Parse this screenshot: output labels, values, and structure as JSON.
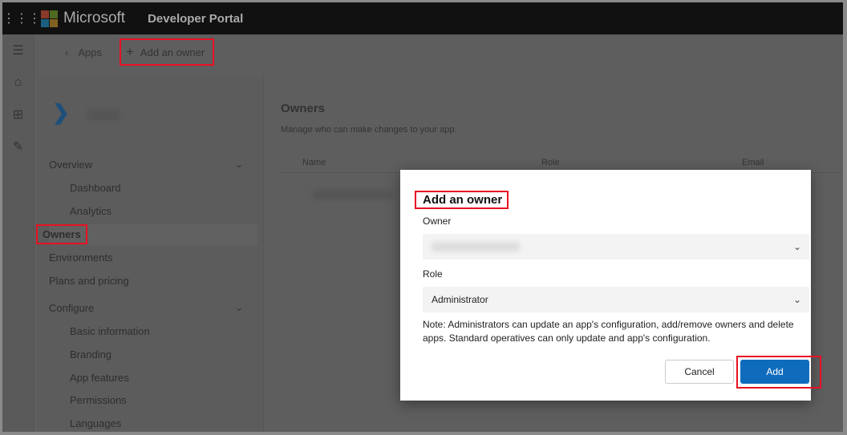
{
  "header": {
    "brand": "Microsoft",
    "portal": "Developer Portal",
    "logo_colors": [
      "#f25022",
      "#7fba00",
      "#00a4ef",
      "#ffb900"
    ]
  },
  "rail": {
    "icons": [
      "menu-icon",
      "home-icon",
      "apps-icon",
      "edit-icon"
    ]
  },
  "breadcrumb": {
    "back": "Apps",
    "current": "Add an owner"
  },
  "sidebar": {
    "groups": [
      {
        "label": "Overview",
        "items": [
          "Dashboard",
          "Analytics"
        ]
      },
      {
        "label": "Configure",
        "items": [
          "Basic information",
          "Branding",
          "App features",
          "Permissions",
          "Languages"
        ]
      }
    ],
    "top_items": [
      "Owners",
      "Environments",
      "Plans and pricing"
    ],
    "selected": "Owners"
  },
  "main": {
    "title": "Owners",
    "subtitle": "Manage who can make changes to your app.",
    "columns": [
      "Name",
      "Role",
      "Email"
    ]
  },
  "dialog": {
    "title": "Add an owner",
    "owner_label": "Owner",
    "role_label": "Role",
    "role_value": "Administrator",
    "note": "Note: Administrators can update an app's configuration, add/remove owners and delete apps. Standard operatives can only update and app's configuration.",
    "cancel": "Cancel",
    "add": "Add",
    "accent": "#0f6cbd",
    "highlight": "#e81123"
  }
}
